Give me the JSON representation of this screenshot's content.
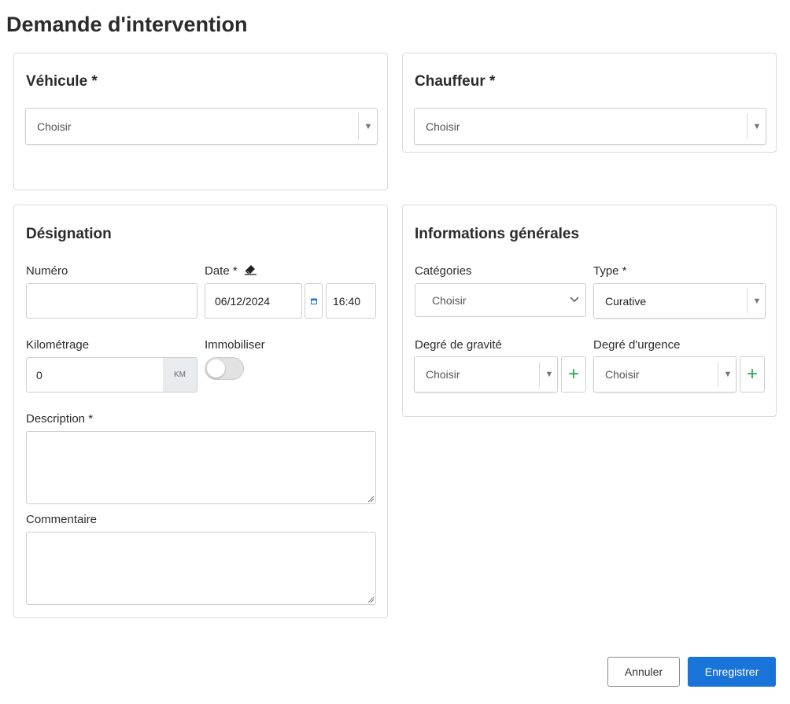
{
  "page": {
    "title": "Demande d'intervention"
  },
  "vehicule": {
    "title": "Véhicule *",
    "select_value": "Choisir"
  },
  "chauffeur": {
    "title": "Chauffeur *",
    "select_value": "Choisir"
  },
  "designation": {
    "title": "Désignation",
    "numero_label": "Numéro",
    "numero_value": "",
    "date_label": "Date *",
    "date_value": "06/12/2024",
    "time_value": "16:40",
    "kilometrage_label": "Kilométrage",
    "kilometrage_value": "0",
    "kilometrage_unit": "KM",
    "immobiliser_label": "Immobiliser",
    "immobiliser_on": false,
    "description_label": "Description *",
    "description_value": "",
    "commentaire_label": "Commentaire",
    "commentaire_value": ""
  },
  "informations": {
    "title": "Informations générales",
    "categories_label": "Catégories",
    "categories_value": "Choisir",
    "type_label": "Type *",
    "type_value": "Curative",
    "gravite_label": "Degré de gravité",
    "gravite_value": "Choisir",
    "urgence_label": "Degré d'urgence",
    "urgence_value": "Choisir",
    "add_symbol": "+"
  },
  "actions": {
    "cancel_label": "Annuler",
    "save_label": "Enregistrer"
  },
  "icons": {
    "dropdown": "caret-down-icon",
    "calendar": "calendar-icon",
    "eraser": "eraser-icon",
    "add": "plus-icon"
  },
  "colors": {
    "primary": "#1a73d9",
    "add": "#28a745",
    "border": "#dcdcdc"
  }
}
